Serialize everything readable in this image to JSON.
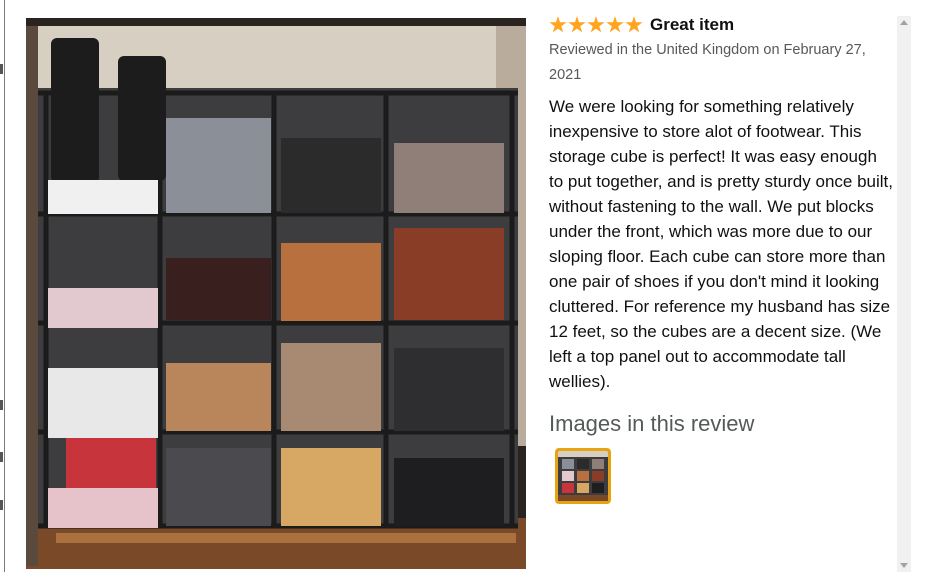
{
  "review": {
    "rating": 5,
    "title": "Great item",
    "meta": "Reviewed in the United Kingdom on February 27, 2021",
    "body": "We were looking for something relatively inexpensive to store alot of footwear. This storage cube is perfect! It was easy enough to put together, and is pretty sturdy once built, without fastening to the wall. We put blocks under the front, which was more due to our sloping floor. Each cube can store more than one pair of shoes if you don't mind it looking cluttered. For reference my husband has size 12 feet, so the cubes are a decent size. (We left a top panel out to accommodate tall wellies).",
    "images_heading": "Images in this review"
  },
  "colors": {
    "star": "#ffa41c",
    "thumb_border": "#e7a412",
    "meta_text": "#565959",
    "body_text": "#0f1111"
  },
  "icons": {
    "star": "star-icon",
    "scroll_up": "chevron-up-icon",
    "scroll_down": "chevron-down-icon"
  }
}
